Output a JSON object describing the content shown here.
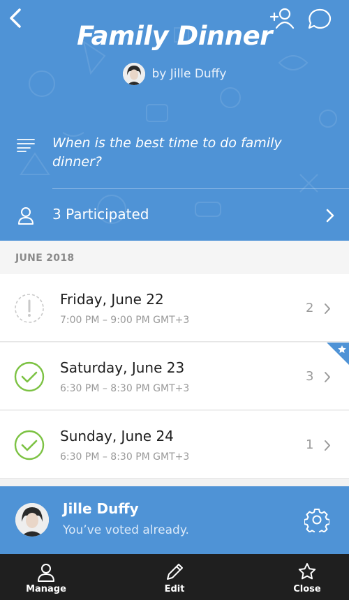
{
  "header": {
    "title": "Family Dinner",
    "byline": "by Jille Duffy",
    "icons": {
      "back": "back-chevron-icon",
      "add_participant": "add-person-icon",
      "chat": "chat-bubble-icon"
    }
  },
  "question": {
    "text": "When is the best time to do family dinner?",
    "icon": "description-lines-icon"
  },
  "participants": {
    "label": "3 Participated",
    "icon": "person-icon"
  },
  "month_header": "JUNE 2018",
  "options": [
    {
      "date": "Friday, June 22",
      "time": "7:00 PM – 9:00 PM GMT+3",
      "count": "2",
      "status": "pending",
      "starred": false
    },
    {
      "date": "Saturday, June 23",
      "time": "6:30 PM – 8:30 PM GMT+3",
      "count": "3",
      "status": "voted",
      "starred": true
    },
    {
      "date": "Sunday, June 24",
      "time": "6:30 PM – 8:30 PM GMT+3",
      "count": "1",
      "status": "voted",
      "starred": false
    }
  ],
  "voter": {
    "name": "Jille Duffy",
    "status": "You’ve voted already."
  },
  "tabs": [
    {
      "label": "Manage",
      "icon": "person-icon"
    },
    {
      "label": "Edit",
      "icon": "pencil-icon"
    },
    {
      "label": "Close",
      "icon": "star-icon"
    }
  ],
  "colors": {
    "accent": "#4f93d6",
    "success": "#7cc243",
    "tabbar": "#1f1f1f"
  }
}
